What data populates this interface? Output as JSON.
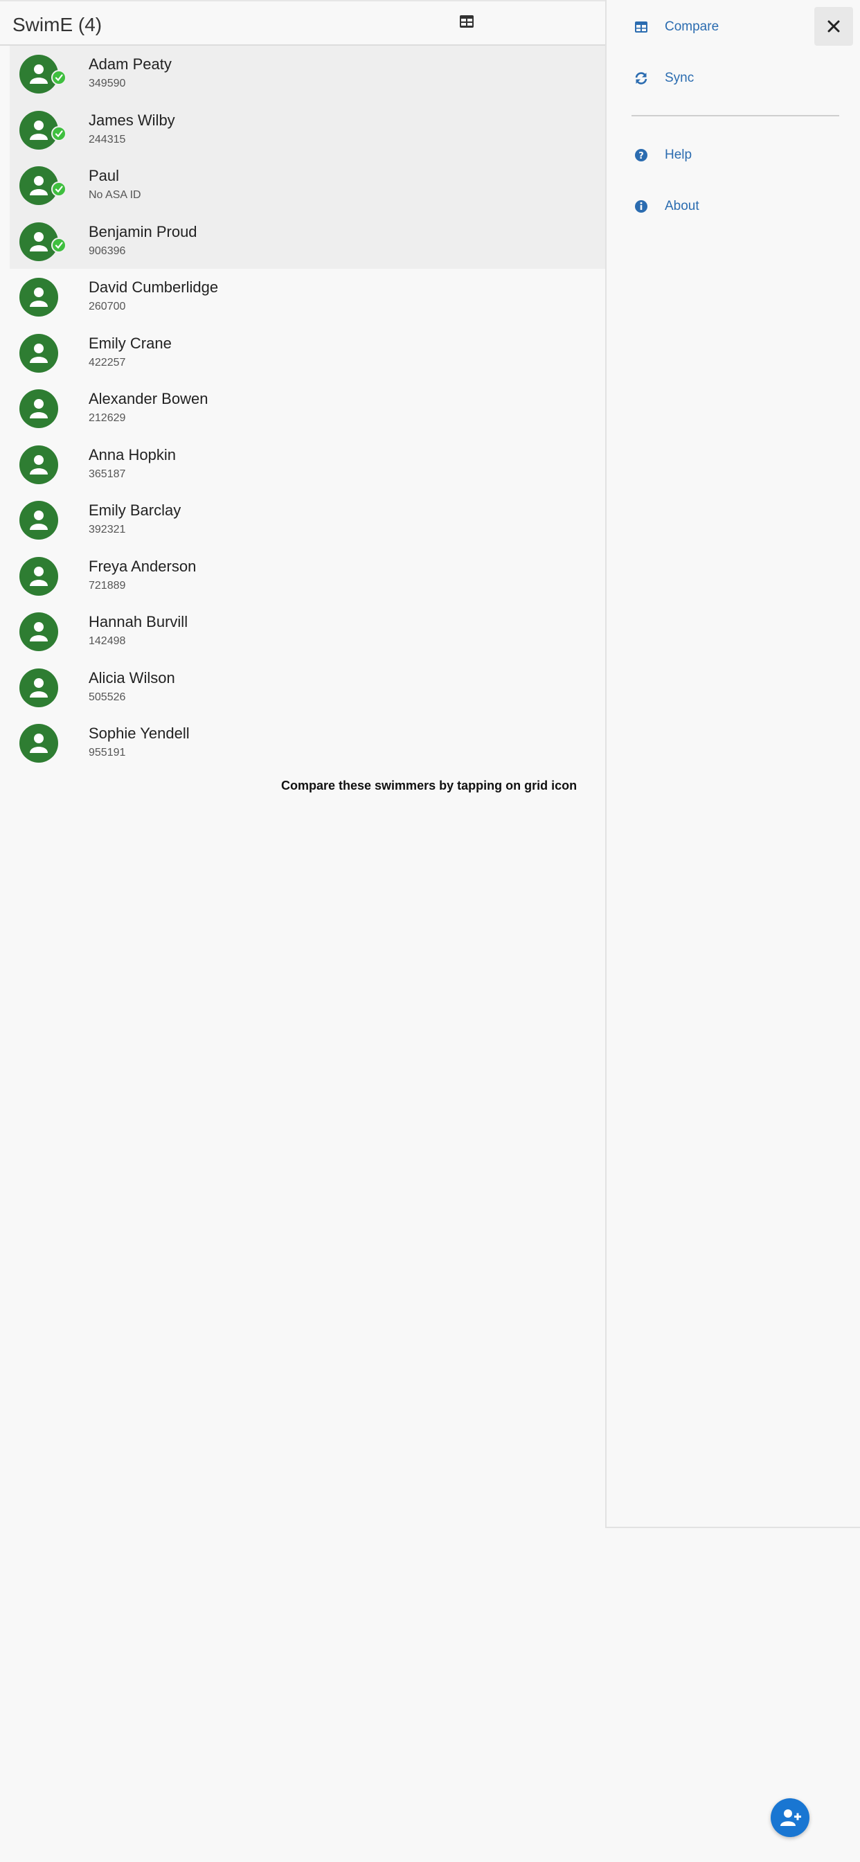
{
  "app": {
    "title": "SwimE (4)"
  },
  "swimmers": [
    {
      "name": "Adam Peaty",
      "id": "349590",
      "selected": true
    },
    {
      "name": "James Wilby",
      "id": "244315",
      "selected": true
    },
    {
      "name": "Paul",
      "id": "No ASA ID",
      "selected": true
    },
    {
      "name": "Benjamin Proud",
      "id": "906396",
      "selected": true
    },
    {
      "name": "David Cumberlidge",
      "id": "260700",
      "selected": false
    },
    {
      "name": "Emily Crane",
      "id": "422257",
      "selected": false
    },
    {
      "name": "Alexander Bowen",
      "id": "212629",
      "selected": false
    },
    {
      "name": "Anna Hopkin",
      "id": "365187",
      "selected": false
    },
    {
      "name": "Emily Barclay",
      "id": "392321",
      "selected": false
    },
    {
      "name": "Freya Anderson",
      "id": "721889",
      "selected": false
    },
    {
      "name": "Hannah Burvill",
      "id": "142498",
      "selected": false
    },
    {
      "name": "Alicia Wilson",
      "id": "505526",
      "selected": false
    },
    {
      "name": "Sophie Yendell",
      "id": "955191",
      "selected": false
    }
  ],
  "hint": "Compare these swimmers by tapping on grid icon",
  "drawer": {
    "items": [
      {
        "label": "Compare",
        "icon": "table-icon"
      },
      {
        "label": "Sync",
        "icon": "sync-icon"
      },
      {
        "label": "Help",
        "icon": "help-icon"
      },
      {
        "label": "About",
        "icon": "info-icon"
      }
    ]
  },
  "colors": {
    "avatar": "#2e7d32",
    "check": "#3fbf3f",
    "accent": "#2b6cb0",
    "fab": "#1976d2"
  }
}
